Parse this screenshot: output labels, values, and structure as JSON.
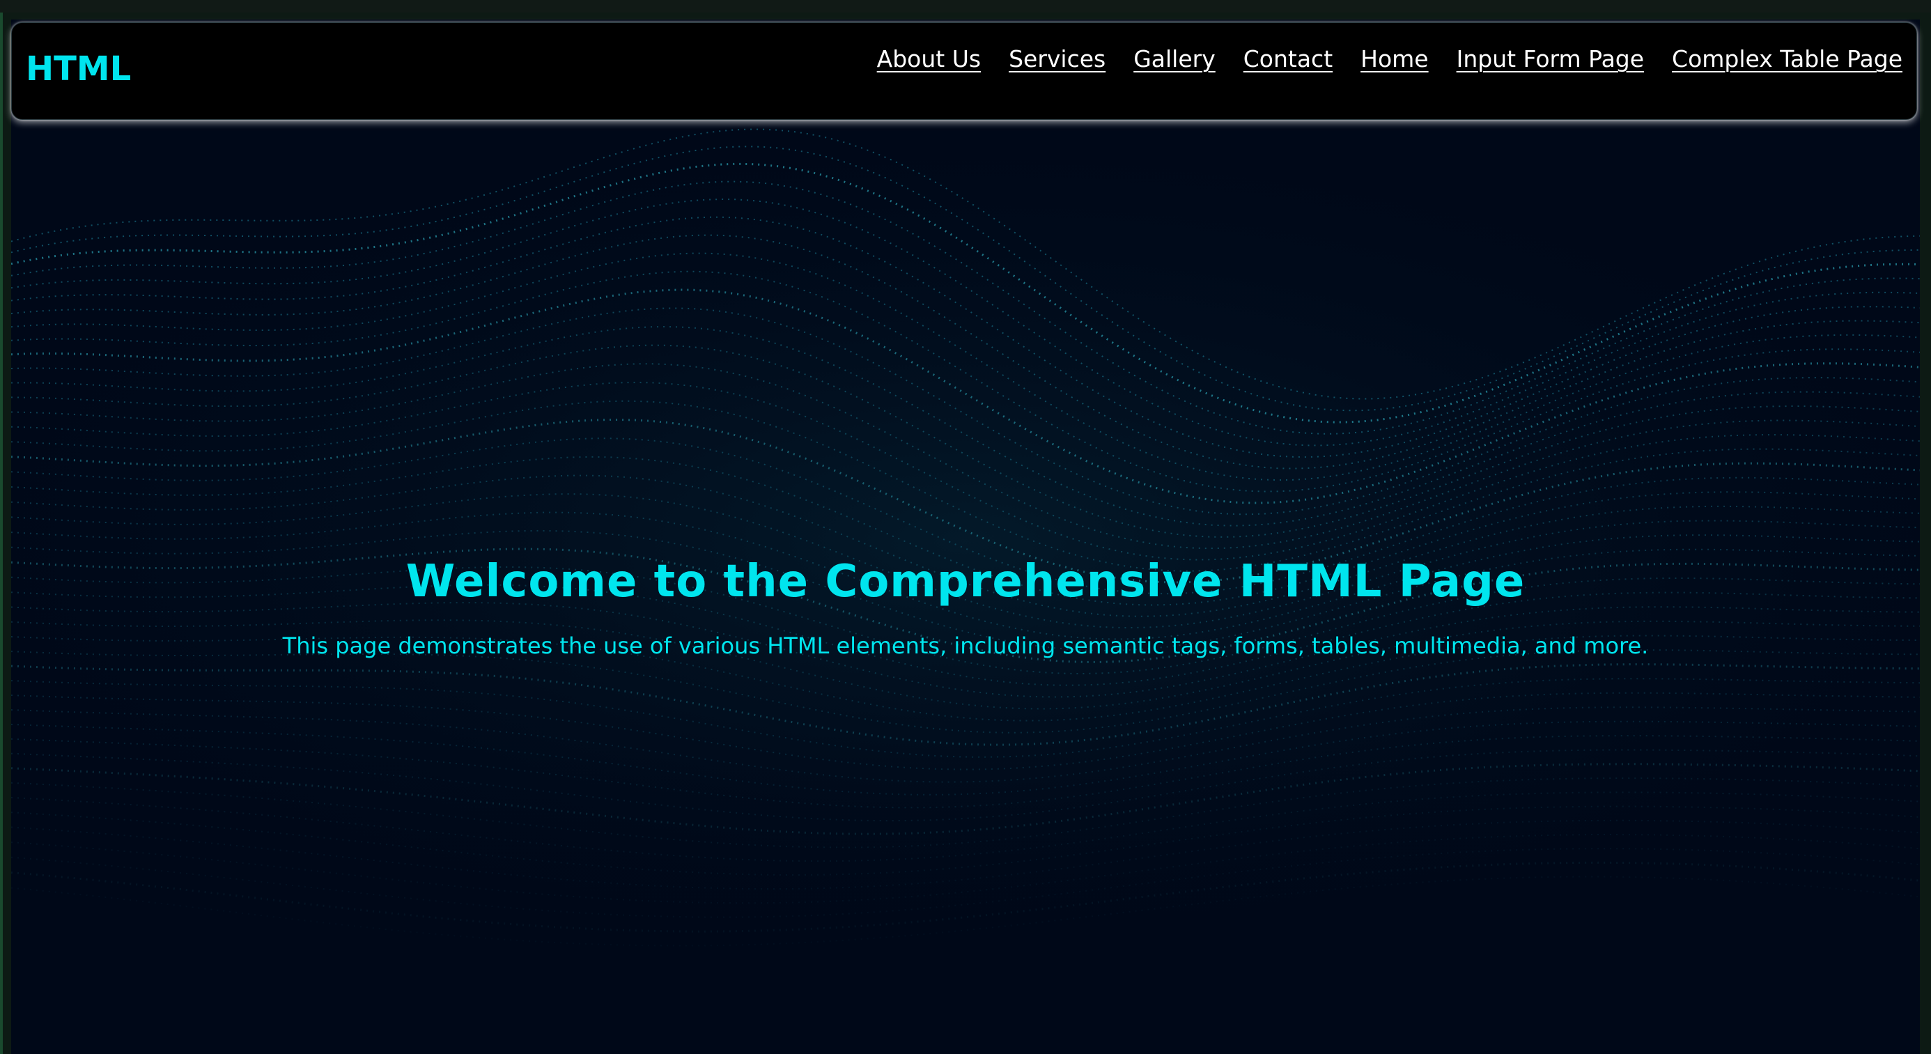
{
  "brand": "HTML",
  "nav": [
    {
      "label": "About Us"
    },
    {
      "label": "Services"
    },
    {
      "label": "Gallery"
    },
    {
      "label": "Contact"
    },
    {
      "label": "Home"
    },
    {
      "label": "Input Form Page"
    },
    {
      "label": "Complex Table Page"
    }
  ],
  "hero": {
    "title": "Welcome to the Comprehensive HTML Page",
    "subtitle": "This page demonstrates the use of various HTML elements, including semantic tags, forms, tables, multimedia, and more."
  },
  "colors": {
    "accent": "#00e5ee",
    "background": "#000818",
    "navbar": "#000000",
    "link": "#ffffff"
  }
}
